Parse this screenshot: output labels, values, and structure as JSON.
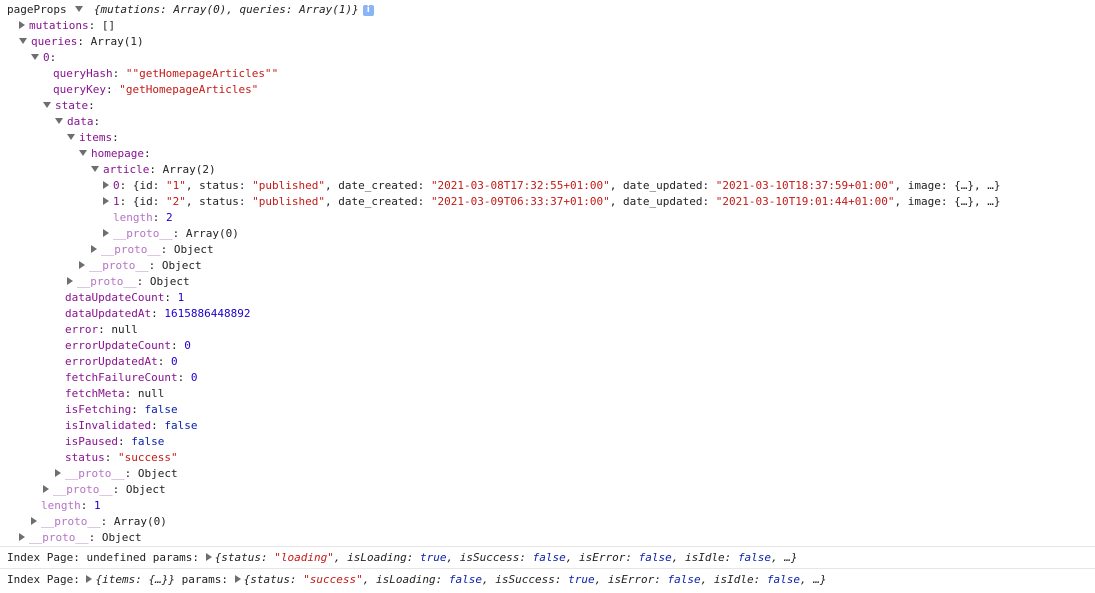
{
  "tree": [
    {
      "indent": 0,
      "arrow": "none",
      "label": "pageProps",
      "sep": "",
      "value": [
        {
          "t": "▼",
          "c": "arr-inline"
        },
        {
          "t": " {mutations: Array(0), queries: Array(1)}",
          "c": "v it"
        }
      ],
      "info": "i"
    },
    {
      "indent": 1,
      "arrow": "right",
      "label": "mutations",
      "value": [
        {
          "t": "[]",
          "c": "v"
        }
      ]
    },
    {
      "indent": 1,
      "arrow": "down",
      "label": "queries",
      "value": [
        {
          "t": "Array(1)",
          "c": "v"
        }
      ]
    },
    {
      "indent": 2,
      "arrow": "down",
      "label": "0",
      "value": []
    },
    {
      "indent": 3,
      "arrow": "none",
      "label": "queryHash",
      "value": [
        {
          "t": "\"",
          "c": "s"
        },
        {
          "t": "\"getHomepageArticles\"",
          "c": "s"
        },
        {
          "t": "\"",
          "c": "s"
        }
      ]
    },
    {
      "indent": 3,
      "arrow": "none",
      "label": "queryKey",
      "value": [
        {
          "t": "\"getHomepageArticles\"",
          "c": "s"
        }
      ]
    },
    {
      "indent": 3,
      "arrow": "down",
      "label": "state",
      "value": []
    },
    {
      "indent": 4,
      "arrow": "down",
      "label": "data",
      "value": []
    },
    {
      "indent": 5,
      "arrow": "down",
      "label": "items",
      "value": []
    },
    {
      "indent": 6,
      "arrow": "down",
      "label": "homepage",
      "value": []
    },
    {
      "indent": 7,
      "arrow": "down",
      "label": "article",
      "value": [
        {
          "t": "Array(2)",
          "c": "v"
        }
      ]
    },
    {
      "indent": 8,
      "arrow": "right",
      "label": "0",
      "value": [
        {
          "t": "{id: ",
          "c": "v"
        },
        {
          "t": "\"1\"",
          "c": "s"
        },
        {
          "t": ", status: ",
          "c": "v"
        },
        {
          "t": "\"published\"",
          "c": "s"
        },
        {
          "t": ", date_created: ",
          "c": "v"
        },
        {
          "t": "\"2021-03-08T17:32:55+01:00\"",
          "c": "s"
        },
        {
          "t": ", date_updated: ",
          "c": "v"
        },
        {
          "t": "\"2021-03-10T18:37:59+01:00\"",
          "c": "s"
        },
        {
          "t": ", image: {…}, …}",
          "c": "v"
        }
      ]
    },
    {
      "indent": 8,
      "arrow": "right",
      "label": "1",
      "value": [
        {
          "t": "{id: ",
          "c": "v"
        },
        {
          "t": "\"2\"",
          "c": "s"
        },
        {
          "t": ", status: ",
          "c": "v"
        },
        {
          "t": "\"published\"",
          "c": "s"
        },
        {
          "t": ", date_created: ",
          "c": "v"
        },
        {
          "t": "\"2021-03-09T06:33:37+01:00\"",
          "c": "s"
        },
        {
          "t": ", date_updated: ",
          "c": "v"
        },
        {
          "t": "\"2021-03-10T19:01:44+01:00\"",
          "c": "s"
        },
        {
          "t": ", image: {…}, …}",
          "c": "v"
        }
      ]
    },
    {
      "indent": 8,
      "arrow": "none",
      "label": "length",
      "dim": true,
      "value": [
        {
          "t": "2",
          "c": "n"
        }
      ]
    },
    {
      "indent": 8,
      "arrow": "right",
      "label": "__proto__",
      "dim": true,
      "value": [
        {
          "t": "Array(0)",
          "c": "v"
        }
      ]
    },
    {
      "indent": 7,
      "arrow": "right",
      "label": "__proto__",
      "dim": true,
      "value": [
        {
          "t": "Object",
          "c": "v"
        }
      ]
    },
    {
      "indent": 6,
      "arrow": "right",
      "label": "__proto__",
      "dim": true,
      "value": [
        {
          "t": "Object",
          "c": "v"
        }
      ]
    },
    {
      "indent": 5,
      "arrow": "right",
      "label": "__proto__",
      "dim": true,
      "value": [
        {
          "t": "Object",
          "c": "v"
        }
      ]
    },
    {
      "indent": 4,
      "arrow": "none",
      "label": "dataUpdateCount",
      "value": [
        {
          "t": "1",
          "c": "n"
        }
      ]
    },
    {
      "indent": 4,
      "arrow": "none",
      "label": "dataUpdatedAt",
      "value": [
        {
          "t": "1615886448892",
          "c": "n"
        }
      ]
    },
    {
      "indent": 4,
      "arrow": "none",
      "label": "error",
      "value": [
        {
          "t": "null",
          "c": "v"
        }
      ]
    },
    {
      "indent": 4,
      "arrow": "none",
      "label": "errorUpdateCount",
      "value": [
        {
          "t": "0",
          "c": "n"
        }
      ]
    },
    {
      "indent": 4,
      "arrow": "none",
      "label": "errorUpdatedAt",
      "value": [
        {
          "t": "0",
          "c": "n"
        }
      ]
    },
    {
      "indent": 4,
      "arrow": "none",
      "label": "fetchFailureCount",
      "value": [
        {
          "t": "0",
          "c": "n"
        }
      ]
    },
    {
      "indent": 4,
      "arrow": "none",
      "label": "fetchMeta",
      "value": [
        {
          "t": "null",
          "c": "v"
        }
      ]
    },
    {
      "indent": 4,
      "arrow": "none",
      "label": "isFetching",
      "value": [
        {
          "t": "false",
          "c": "kw"
        }
      ]
    },
    {
      "indent": 4,
      "arrow": "none",
      "label": "isInvalidated",
      "value": [
        {
          "t": "false",
          "c": "kw"
        }
      ]
    },
    {
      "indent": 4,
      "arrow": "none",
      "label": "isPaused",
      "value": [
        {
          "t": "false",
          "c": "kw"
        }
      ]
    },
    {
      "indent": 4,
      "arrow": "none",
      "label": "status",
      "value": [
        {
          "t": "\"success\"",
          "c": "s"
        }
      ]
    },
    {
      "indent": 4,
      "arrow": "right",
      "label": "__proto__",
      "dim": true,
      "value": [
        {
          "t": "Object",
          "c": "v"
        }
      ]
    },
    {
      "indent": 3,
      "arrow": "right",
      "label": "__proto__",
      "dim": true,
      "value": [
        {
          "t": "Object",
          "c": "v"
        }
      ]
    },
    {
      "indent": 2,
      "arrow": "none",
      "label": "length",
      "dim": true,
      "value": [
        {
          "t": "1",
          "c": "n"
        }
      ]
    },
    {
      "indent": 2,
      "arrow": "right",
      "label": "__proto__",
      "dim": true,
      "value": [
        {
          "t": "Array(0)",
          "c": "v"
        }
      ]
    },
    {
      "indent": 1,
      "arrow": "right",
      "label": "__proto__",
      "dim": true,
      "value": [
        {
          "t": "Object",
          "c": "v"
        }
      ]
    }
  ],
  "logs": [
    {
      "prefix": "Index Page: undefined params: ",
      "parts": [
        {
          "t": "{status: ",
          "c": "v it"
        },
        {
          "t": "\"loading\"",
          "c": "s it"
        },
        {
          "t": ", isLoading: ",
          "c": "v it"
        },
        {
          "t": "true",
          "c": "kw it"
        },
        {
          "t": ", isSuccess: ",
          "c": "v it"
        },
        {
          "t": "false",
          "c": "kw it"
        },
        {
          "t": ", isError: ",
          "c": "v it"
        },
        {
          "t": "false",
          "c": "kw it"
        },
        {
          "t": ", isIdle: ",
          "c": "v it"
        },
        {
          "t": "false",
          "c": "kw it"
        },
        {
          "t": ", …}",
          "c": "v it"
        }
      ]
    },
    {
      "prefix": "Index Page: ",
      "mid": "{items: {…}}",
      "mid2": " params: ",
      "parts": [
        {
          "t": "{status: ",
          "c": "v it"
        },
        {
          "t": "\"success\"",
          "c": "s it"
        },
        {
          "t": ", isLoading: ",
          "c": "v it"
        },
        {
          "t": "false",
          "c": "kw it"
        },
        {
          "t": ", isSuccess: ",
          "c": "v it"
        },
        {
          "t": "true",
          "c": "kw it"
        },
        {
          "t": ", isError: ",
          "c": "v it"
        },
        {
          "t": "false",
          "c": "kw it"
        },
        {
          "t": ", isIdle: ",
          "c": "v it"
        },
        {
          "t": "false",
          "c": "kw it"
        },
        {
          "t": ", …}",
          "c": "v it"
        }
      ]
    }
  ],
  "colors": {
    "key": "#881391",
    "string": "#c41a16",
    "number": "#1c00cf",
    "keyword": "#0d22aa"
  }
}
